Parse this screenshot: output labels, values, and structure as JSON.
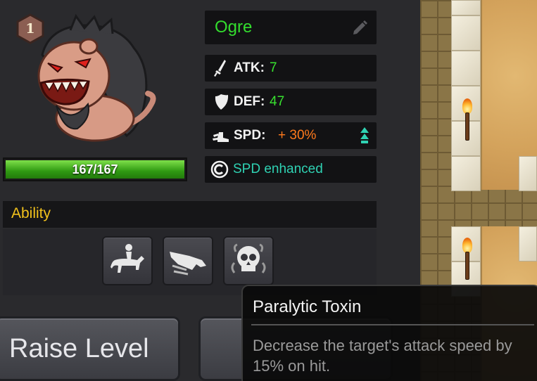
{
  "unit": {
    "level": "1",
    "name": "Ogre",
    "hp": "167/167",
    "hp_fraction": 1.0
  },
  "stats": {
    "atk_label": "ATK:",
    "atk_value": "7",
    "def_label": "DEF:",
    "def_value": "47",
    "spd_label": "SPD:",
    "spd_value": "+ 30%",
    "status": "SPD enhanced"
  },
  "ability": {
    "title": "Ability",
    "items": [
      {
        "icon": "rider-icon"
      },
      {
        "icon": "beast-charge-icon"
      },
      {
        "icon": "skull-icon"
      }
    ]
  },
  "buttons": {
    "raise_level": "Raise Level"
  },
  "tooltip": {
    "title": "Paralytic Toxin",
    "description": "Decrease the target's attack speed by 15% on hit."
  },
  "colors": {
    "name": "#33dd2e",
    "stat_value": "#38e02f",
    "spd_bonus": "#ff7a1c",
    "status": "#2fd2b3",
    "ability_title": "#f2c21c"
  }
}
